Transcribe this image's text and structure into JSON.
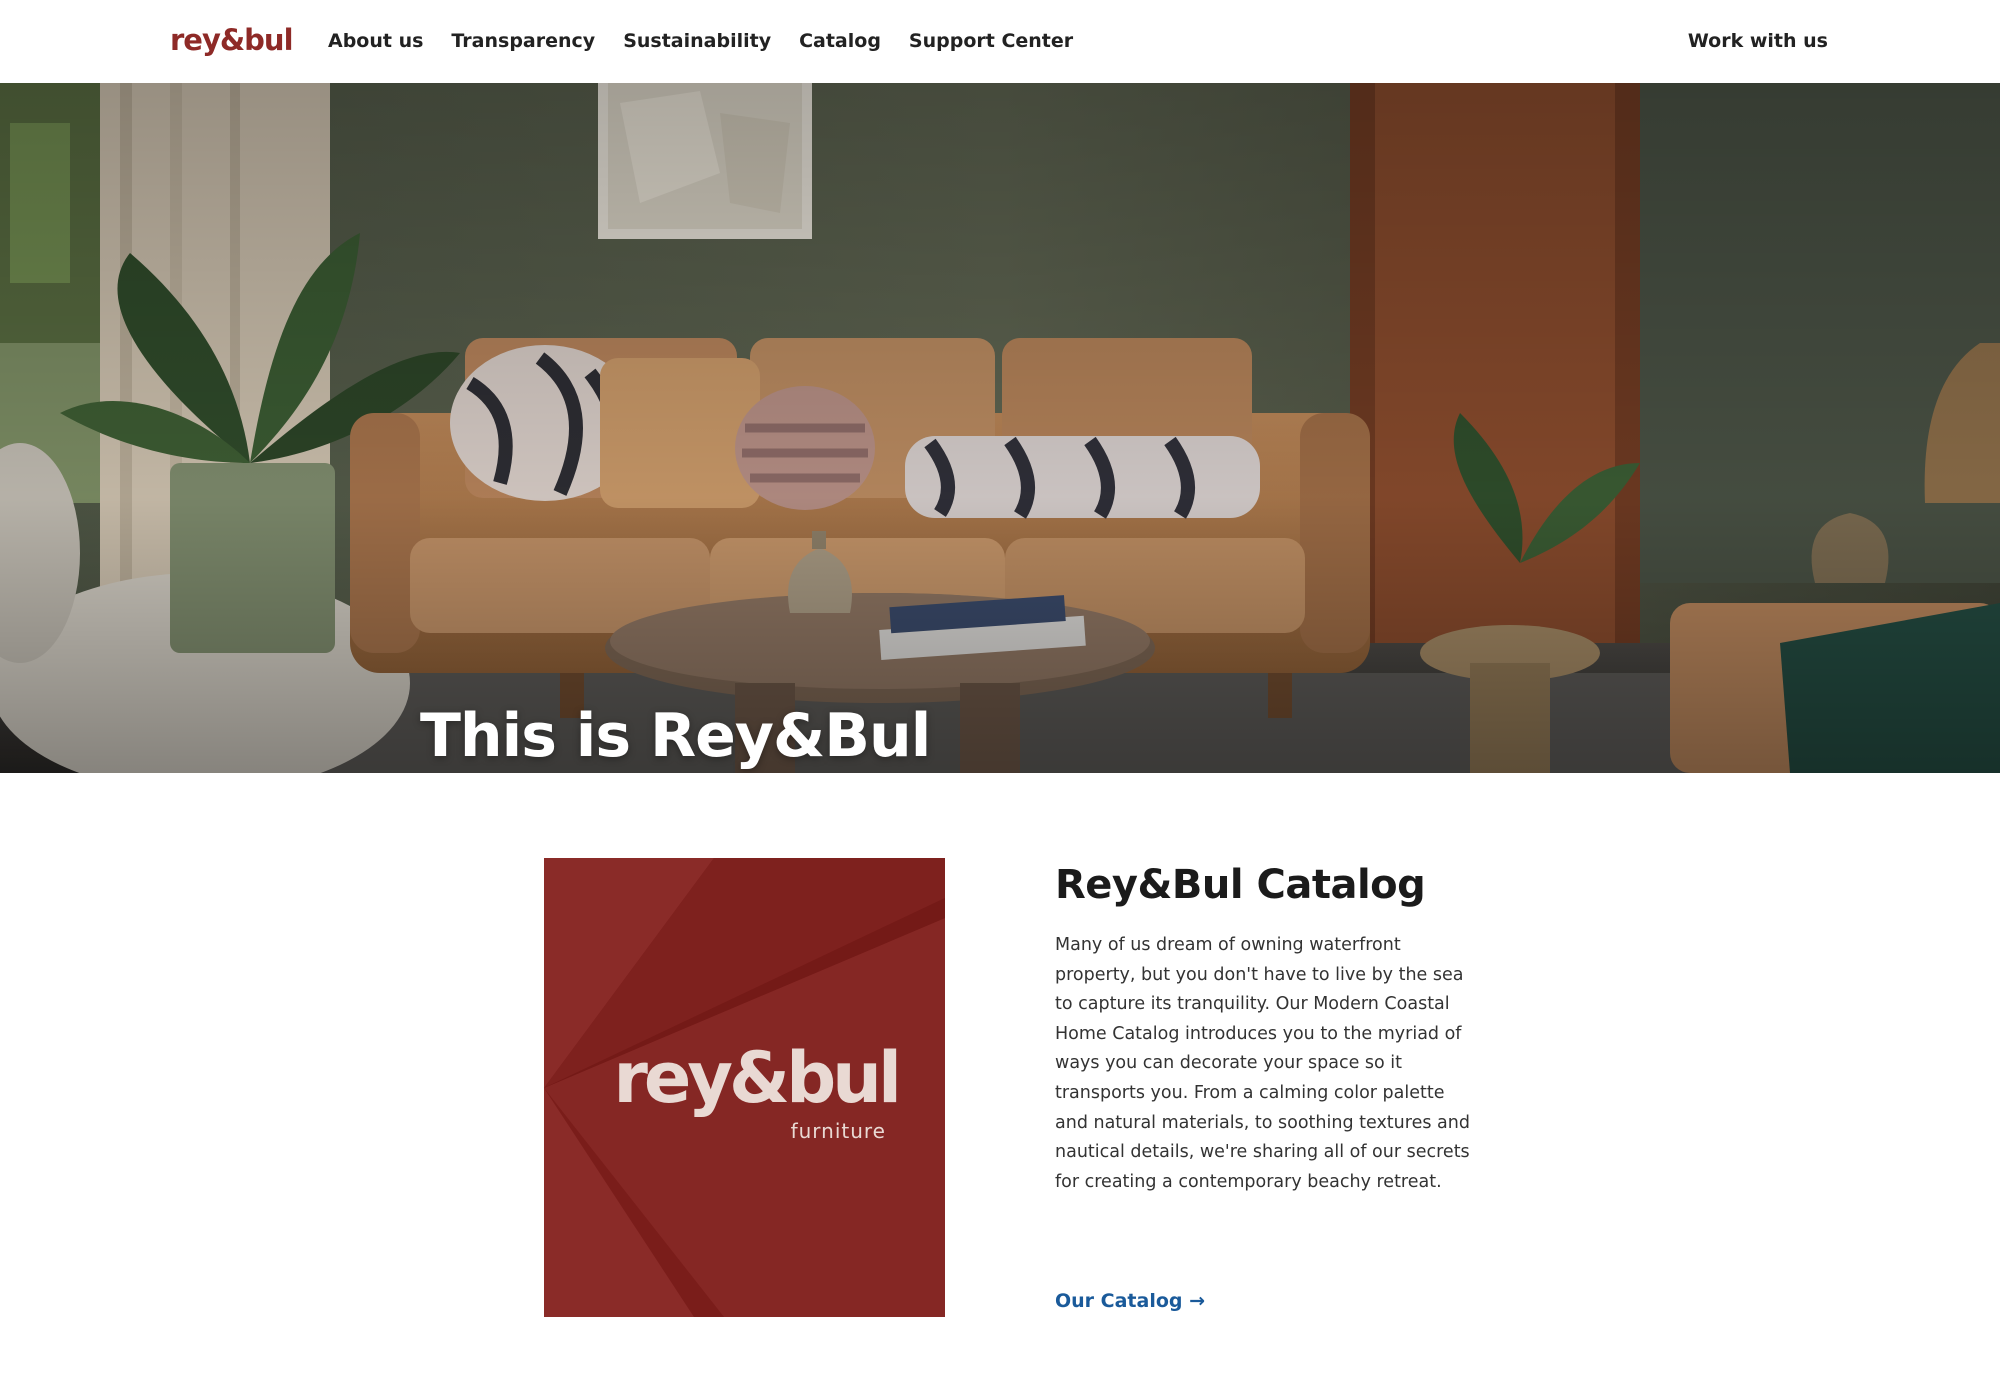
{
  "brand": {
    "logo_text": "rey&bul",
    "color": "#8e2a27"
  },
  "header": {
    "nav": [
      {
        "label": "About us"
      },
      {
        "label": "Transparency"
      },
      {
        "label": "Sustainability"
      },
      {
        "label": "Catalog"
      },
      {
        "label": "Support Center"
      }
    ],
    "cta_label": "Work with us"
  },
  "hero": {
    "title": "This is Rey&Bul",
    "image_icon": "living-room-photo"
  },
  "catalog": {
    "image_brand": "rey&bul",
    "image_subtitle": "furniture",
    "image_color": "#7a1d1a",
    "heading": "Rey&Bul Catalog",
    "description": "Many of us dream of owning waterfront property, but you don't have to live by the sea to capture its tranquility. Our Modern Coastal Home Catalog introduces you to the myriad of ways you can decorate your space so it transports you. From a calming color palette and natural materials, to soothing textures and nautical details, we're sharing all of our secrets for creating a contemporary beachy retreat.",
    "link_label": "Our Catalog →",
    "link_color": "#1a5a9a"
  }
}
